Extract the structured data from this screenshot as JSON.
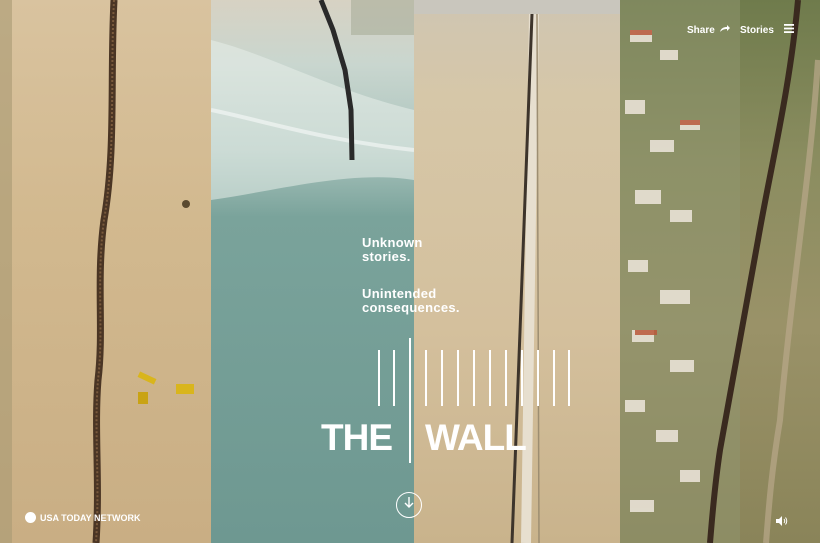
{
  "header": {
    "share_label": "Share",
    "stories_label": "Stories"
  },
  "hero": {
    "line1": "Unknown stories.",
    "line2": "Unintended consequences.",
    "title_left": "THE",
    "title_right": "WALL"
  },
  "footer": {
    "network_label": "USA TODAY NETWORK"
  },
  "icons": {
    "share": "share-arrow-icon",
    "menu": "hamburger-menu-icon",
    "scroll": "arrow-down-icon",
    "sound": "speaker-icon",
    "logo": "usa-today-dot-icon"
  },
  "colors": {
    "text": "#ffffff",
    "sand": "#d2b98f",
    "sea": "#6e9891"
  }
}
